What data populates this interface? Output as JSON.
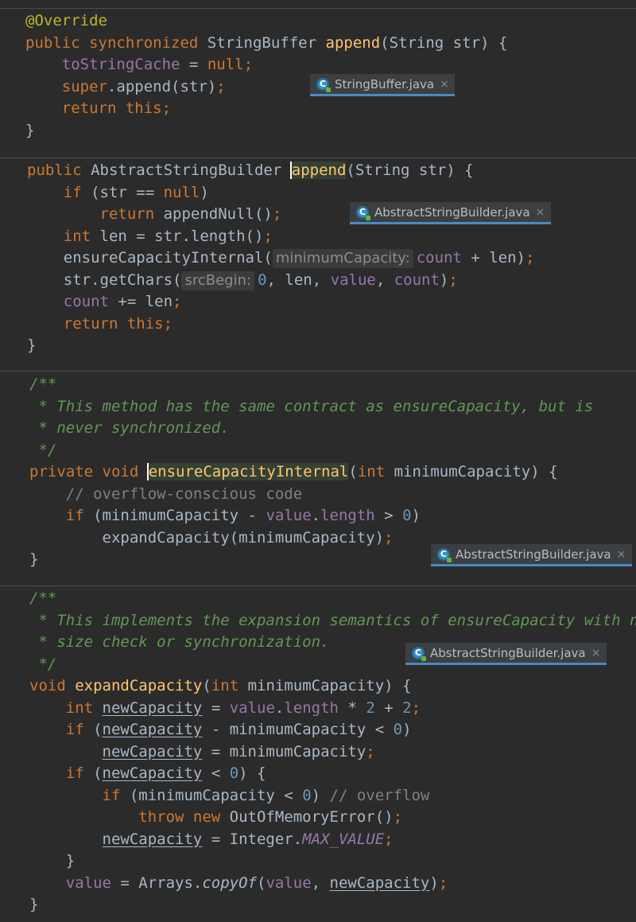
{
  "sections": [
    {
      "file_tab": "StringBuffer.java",
      "lines": [
        [
          {
            "t": "@Override",
            "c": "ann"
          }
        ],
        [
          {
            "t": "public ",
            "c": "kw"
          },
          {
            "t": "synchronized ",
            "c": "kw"
          },
          {
            "t": "StringBuffer "
          },
          {
            "t": "append",
            "c": "fn"
          },
          {
            "t": "(String str) {"
          }
        ],
        [
          {
            "t": "    "
          },
          {
            "t": "toStringCache",
            "c": "fld"
          },
          {
            "t": " = "
          },
          {
            "t": "null",
            "c": "kw"
          },
          {
            "t": ";",
            "c": "kw"
          }
        ],
        [
          {
            "t": "    "
          },
          {
            "t": "super",
            "c": "kw"
          },
          {
            "t": ".append(str)"
          },
          {
            "t": ";",
            "c": "kw"
          }
        ],
        [
          {
            "t": "    "
          },
          {
            "t": "return this",
            "c": "kw"
          },
          {
            "t": ";",
            "c": "kw"
          }
        ],
        [
          {
            "t": "}"
          }
        ]
      ]
    },
    {
      "file_tab": "AbstractStringBuilder.java",
      "lines": [
        [
          {
            "t": "public ",
            "c": "kw"
          },
          {
            "t": "AbstractStringBuilder "
          },
          {
            "t": "append",
            "c": "fn",
            "caret": true
          },
          {
            "t": "(String str) {"
          }
        ],
        [
          {
            "t": "    "
          },
          {
            "t": "if ",
            "c": "kw"
          },
          {
            "t": "(str == "
          },
          {
            "t": "null",
            "c": "kw"
          },
          {
            "t": ")"
          }
        ],
        [
          {
            "t": "        "
          },
          {
            "t": "return ",
            "c": "kw"
          },
          {
            "t": "appendNull()"
          },
          {
            "t": ";",
            "c": "kw"
          }
        ],
        [
          {
            "t": "    "
          },
          {
            "t": "int ",
            "c": "kw"
          },
          {
            "t": "len = str.length()"
          },
          {
            "t": ";",
            "c": "kw"
          }
        ],
        [
          {
            "t": "    ensureCapacityInternal("
          },
          {
            "hint": "minimumCapacity:"
          },
          {
            "t": "count",
            "c": "fld"
          },
          {
            "t": " + len)"
          },
          {
            "t": ";",
            "c": "kw"
          }
        ],
        [
          {
            "t": "    str.getChars("
          },
          {
            "hint": "srcBegin:"
          },
          {
            "t": "0",
            "c": "num"
          },
          {
            "t": ", "
          },
          {
            "t": "len, "
          },
          {
            "t": "value",
            "c": "fld"
          },
          {
            "t": ", "
          },
          {
            "t": "count",
            "c": "fld"
          },
          {
            "t": ")"
          },
          {
            "t": ";",
            "c": "kw"
          }
        ],
        [
          {
            "t": "    "
          },
          {
            "t": "count",
            "c": "fld"
          },
          {
            "t": " += len"
          },
          {
            "t": ";",
            "c": "kw"
          }
        ],
        [
          {
            "t": "    "
          },
          {
            "t": "return this",
            "c": "kw"
          },
          {
            "t": ";",
            "c": "kw"
          }
        ],
        [
          {
            "t": "}"
          }
        ]
      ]
    },
    {
      "file_tab": "AbstractStringBuilder.java",
      "lines": [
        [
          {
            "t": "/**",
            "c": "doc"
          }
        ],
        [
          {
            "t": " * This method has the same contract as ensureCapacity, but is",
            "c": "doc"
          }
        ],
        [
          {
            "t": " * never synchronized.",
            "c": "doc"
          }
        ],
        [
          {
            "t": " */",
            "c": "doc"
          }
        ],
        [
          {
            "t": "private ",
            "c": "kw"
          },
          {
            "t": "void ",
            "c": "kw"
          },
          {
            "t": "ensureCapacityInternal",
            "c": "fn",
            "caret": true
          },
          {
            "t": "("
          },
          {
            "t": "int ",
            "c": "kw"
          },
          {
            "t": "minimumCapacity) {"
          }
        ],
        [
          {
            "t": "    "
          },
          {
            "t": "// overflow-conscious code",
            "c": "cmt"
          }
        ],
        [
          {
            "t": "    "
          },
          {
            "t": "if ",
            "c": "kw"
          },
          {
            "t": "(minimumCapacity - "
          },
          {
            "t": "value",
            "c": "fld"
          },
          {
            "t": "."
          },
          {
            "t": "length",
            "c": "fld"
          },
          {
            "t": " > "
          },
          {
            "t": "0",
            "c": "num"
          },
          {
            "t": ")"
          }
        ],
        [
          {
            "t": "        expandCapacity(minimumCapacity)"
          },
          {
            "t": ";",
            "c": "kw"
          }
        ],
        [
          {
            "t": "}"
          }
        ]
      ]
    },
    {
      "file_tab": "AbstractStringBuilder.java",
      "lines": [
        [
          {
            "t": "/**",
            "c": "doc"
          }
        ],
        [
          {
            "t": " * This implements the expansion semantics of ensureCapacity with no",
            "c": "doc"
          }
        ],
        [
          {
            "t": " * size check or synchronization.",
            "c": "doc"
          }
        ],
        [
          {
            "t": " */",
            "c": "doc"
          }
        ],
        [
          {
            "t": "void ",
            "c": "kw"
          },
          {
            "t": "expandCapacity",
            "c": "fn"
          },
          {
            "t": "("
          },
          {
            "t": "int ",
            "c": "kw"
          },
          {
            "t": "minimumCapacity) {"
          }
        ],
        [
          {
            "t": "    "
          },
          {
            "t": "int ",
            "c": "kw"
          },
          {
            "t": "newCapacity",
            "c": "ul"
          },
          {
            "t": " = "
          },
          {
            "t": "value",
            "c": "fld"
          },
          {
            "t": "."
          },
          {
            "t": "length",
            "c": "fld"
          },
          {
            "t": " * "
          },
          {
            "t": "2",
            "c": "num"
          },
          {
            "t": " + "
          },
          {
            "t": "2",
            "c": "num"
          },
          {
            "t": ";",
            "c": "kw"
          }
        ],
        [
          {
            "t": "    "
          },
          {
            "t": "if ",
            "c": "kw"
          },
          {
            "t": "("
          },
          {
            "t": "newCapacity",
            "c": "ul"
          },
          {
            "t": " - minimumCapacity < "
          },
          {
            "t": "0",
            "c": "num"
          },
          {
            "t": ")"
          }
        ],
        [
          {
            "t": "        "
          },
          {
            "t": "newCapacity",
            "c": "ul"
          },
          {
            "t": " = minimumCapacity"
          },
          {
            "t": ";",
            "c": "kw"
          }
        ],
        [
          {
            "t": "    "
          },
          {
            "t": "if ",
            "c": "kw"
          },
          {
            "t": "("
          },
          {
            "t": "newCapacity",
            "c": "ul"
          },
          {
            "t": " < "
          },
          {
            "t": "0",
            "c": "num"
          },
          {
            "t": ") {"
          }
        ],
        [
          {
            "t": "        "
          },
          {
            "t": "if ",
            "c": "kw"
          },
          {
            "t": "(minimumCapacity < "
          },
          {
            "t": "0",
            "c": "num"
          },
          {
            "t": ") "
          },
          {
            "t": "// overflow",
            "c": "cmt"
          }
        ],
        [
          {
            "t": "            "
          },
          {
            "t": "throw new ",
            "c": "kw"
          },
          {
            "t": "OutOfMemoryError()"
          },
          {
            "t": ";",
            "c": "kw"
          }
        ],
        [
          {
            "t": "        "
          },
          {
            "t": "newCapacity",
            "c": "ul"
          },
          {
            "t": " = Integer."
          },
          {
            "t": "MAX_VALUE",
            "c": "st"
          },
          {
            "t": ";",
            "c": "kw"
          }
        ],
        [
          {
            "t": "    }"
          }
        ],
        [
          {
            "t": "    "
          },
          {
            "t": "value",
            "c": "fld"
          },
          {
            "t": " = Arrays."
          },
          {
            "t": "copyOf",
            "c": "it"
          },
          {
            "t": "("
          },
          {
            "t": "value",
            "c": "fld"
          },
          {
            "t": ", "
          },
          {
            "t": "newCapacity",
            "c": "ul"
          },
          {
            "t": ")"
          },
          {
            "t": ";",
            "c": "kw"
          }
        ],
        [
          {
            "t": "}"
          }
        ]
      ]
    }
  ],
  "colors": {
    "background": "#2b2b2b",
    "keyword": "#cc7832",
    "annotation": "#bbb529",
    "method": "#ffc66d",
    "field": "#9876aa",
    "number": "#6897bb",
    "comment": "#808080",
    "doc_comment": "#629755",
    "tab_underline": "#4a88c7"
  },
  "icons": {
    "file_tab_icon": "java-class-icon",
    "file_tab_close": "close-icon",
    "tab_close_glyph": "×"
  }
}
